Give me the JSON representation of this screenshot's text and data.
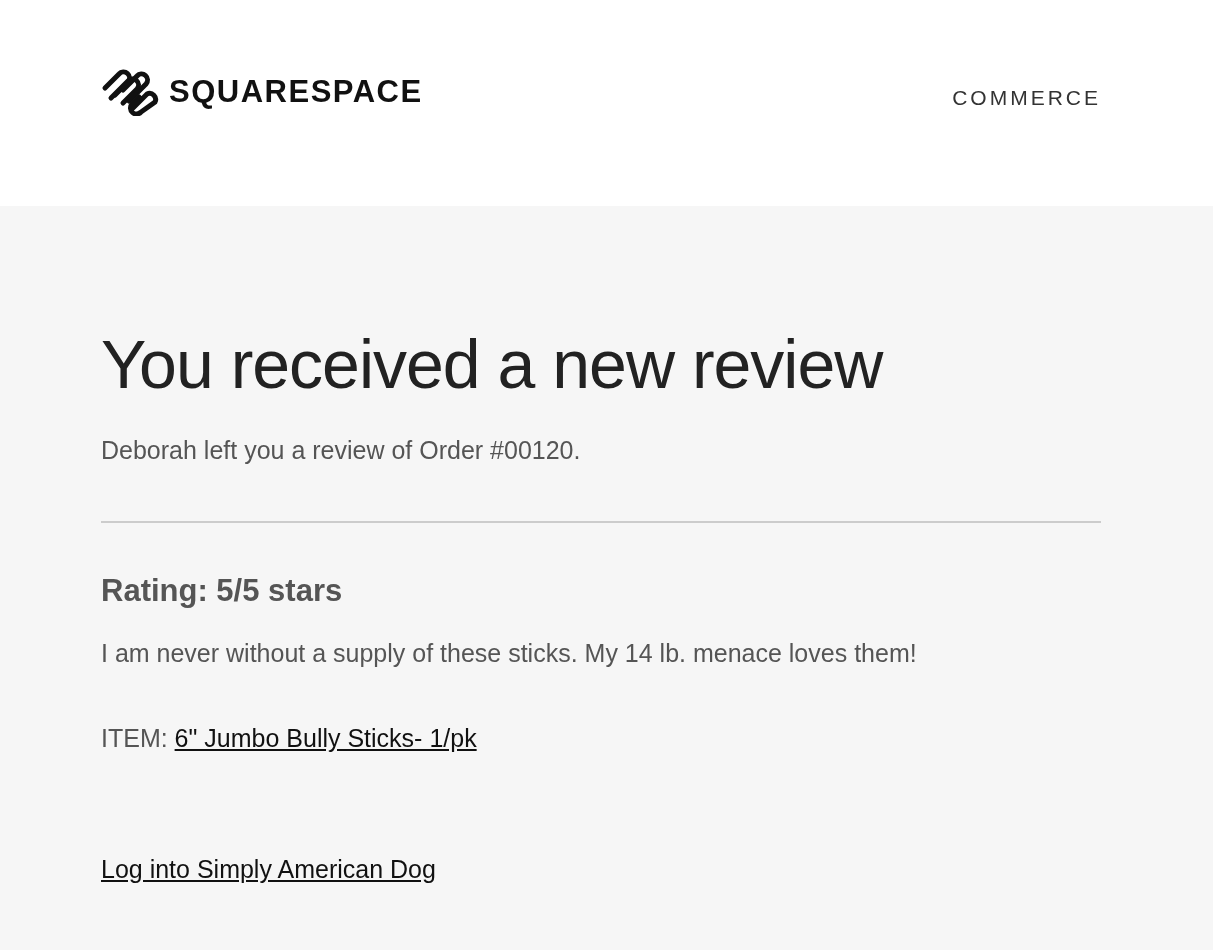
{
  "header": {
    "brand": "SQUARESPACE",
    "nav_link": "COMMERCE"
  },
  "title": "You received a new review",
  "intro": "Deborah left you a review of Order #00120.",
  "rating": "Rating: 5/5 stars",
  "review_text": "I am never without a supply of these sticks. My 14 lb. menace loves them!",
  "item": {
    "label": "ITEM:",
    "link": "6\" Jumbo Bully Sticks- 1/pk"
  },
  "login_link": "Log into Simply American Dog"
}
